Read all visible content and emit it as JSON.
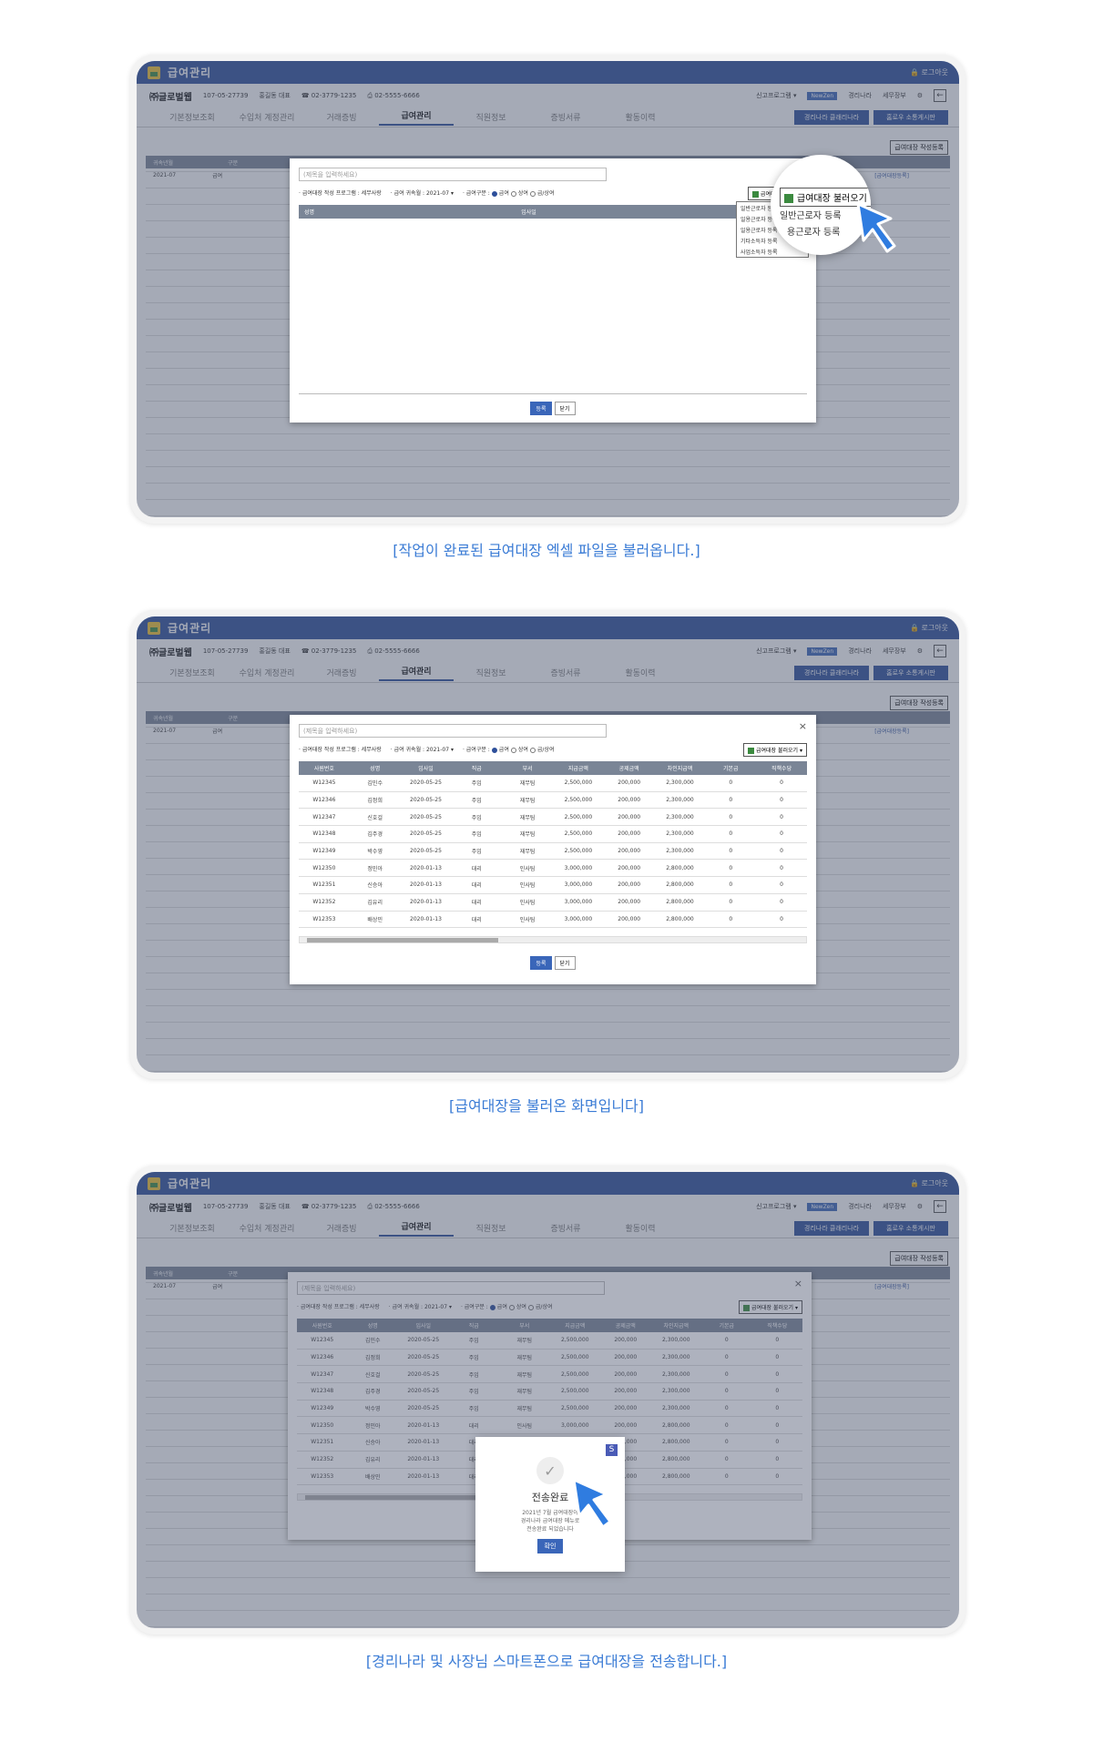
{
  "app": {
    "title": "급여관리",
    "login": "로그아웃",
    "company": "㈜글로벌웹",
    "biz_no": "107-05-27739",
    "ceo": "홍길동 대표",
    "phone": "02-3779-1235",
    "fax": "02-5555-6666",
    "program": "신고프로그램",
    "newzen": "NewZen",
    "keyli": "경리나라",
    "tax": "세무장부",
    "tabs": [
      "기본정보조회",
      "수입처 계정관리",
      "거래증빙",
      "급여관리",
      "직원정보",
      "증빙서류",
      "활동이력"
    ],
    "btn_keyli": "경리나라 클래리나라",
    "btn_soho": "홈로우 소통게시판",
    "btn_reg": "급여대장 작성등록",
    "grid_head": [
      "귀속년월",
      "구분"
    ],
    "grid_row": [
      "2021-07",
      "급여"
    ],
    "grid_link": "[급여대장등록]"
  },
  "modal": {
    "search_placeholder": "(제목을 입력하세요)",
    "program_label": "급여대장 작성 프로그램 : 세무사랑",
    "attr_month_label": "급여 귀속월 :",
    "attr_month": "2021-07",
    "type_label": "급여구분 :",
    "radio_salary": "급여",
    "radio_bonus": "상여",
    "radio_both": "급/상여",
    "load_btn": "급여대장 불러오기",
    "ok": "등록",
    "close": "닫기",
    "empty_cols": [
      "성명",
      "입사일"
    ],
    "columns": [
      "사원번호",
      "성명",
      "입사일",
      "직급",
      "부서",
      "지급금액",
      "공제금액",
      "차인지급액",
      "기본급",
      "직책수당"
    ],
    "rows": [
      [
        "W12345",
        "김민수",
        "2020-05-25",
        "주임",
        "재무팀",
        "2,500,000",
        "200,000",
        "2,300,000",
        "0",
        "0"
      ],
      [
        "W12346",
        "김정희",
        "2020-05-25",
        "주임",
        "재무팀",
        "2,500,000",
        "200,000",
        "2,300,000",
        "0",
        "0"
      ],
      [
        "W12347",
        "신호걸",
        "2020-05-25",
        "주임",
        "재무팀",
        "2,500,000",
        "200,000",
        "2,300,000",
        "0",
        "0"
      ],
      [
        "W12348",
        "김주경",
        "2020-05-25",
        "주임",
        "재무팀",
        "2,500,000",
        "200,000",
        "2,300,000",
        "0",
        "0"
      ],
      [
        "W12349",
        "박수영",
        "2020-05-25",
        "주임",
        "재무팀",
        "2,500,000",
        "200,000",
        "2,300,000",
        "0",
        "0"
      ],
      [
        "W12350",
        "정민아",
        "2020-01-13",
        "대리",
        "인사팀",
        "3,000,000",
        "200,000",
        "2,800,000",
        "0",
        "0"
      ],
      [
        "W12351",
        "신승아",
        "2020-01-13",
        "대리",
        "인사팀",
        "3,000,000",
        "200,000",
        "2,800,000",
        "0",
        "0"
      ],
      [
        "W12352",
        "김유리",
        "2020-01-13",
        "대리",
        "인사팀",
        "3,000,000",
        "200,000",
        "2,800,000",
        "0",
        "0"
      ],
      [
        "W12353",
        "배상민",
        "2020-01-13",
        "대리",
        "인사팀",
        "3,000,000",
        "200,000",
        "2,800,000",
        "0",
        "0"
      ]
    ],
    "dropdown": [
      "일반근로자 등록",
      "일용근로자 등록",
      "일용근로자 등록 (월별)",
      "기타소득자 등록",
      "사업소득자 등록"
    ]
  },
  "zoom": {
    "btn": "급여대장 불러오기",
    "items": [
      "일반근로자 등록",
      "용근로자 등록"
    ]
  },
  "popup": {
    "title": "전송완료",
    "msg1": "2021년 7월 급여대장이",
    "msg2": "경리나라 급여대장 메뉴로",
    "msg3": "전송완료 되었습니다",
    "btn": "확인"
  },
  "captions": [
    "[작업이 완료된 급여대장 엑셀 파일을 불러옵니다.]",
    "[급여대장을 불러온 화면입니다]",
    "[경리나라 및 사장님 스마트폰으로 급여대장을 전송합니다.]"
  ],
  "colors": {
    "primary": "#2d4f9a",
    "caption": "#3a7bd5"
  }
}
